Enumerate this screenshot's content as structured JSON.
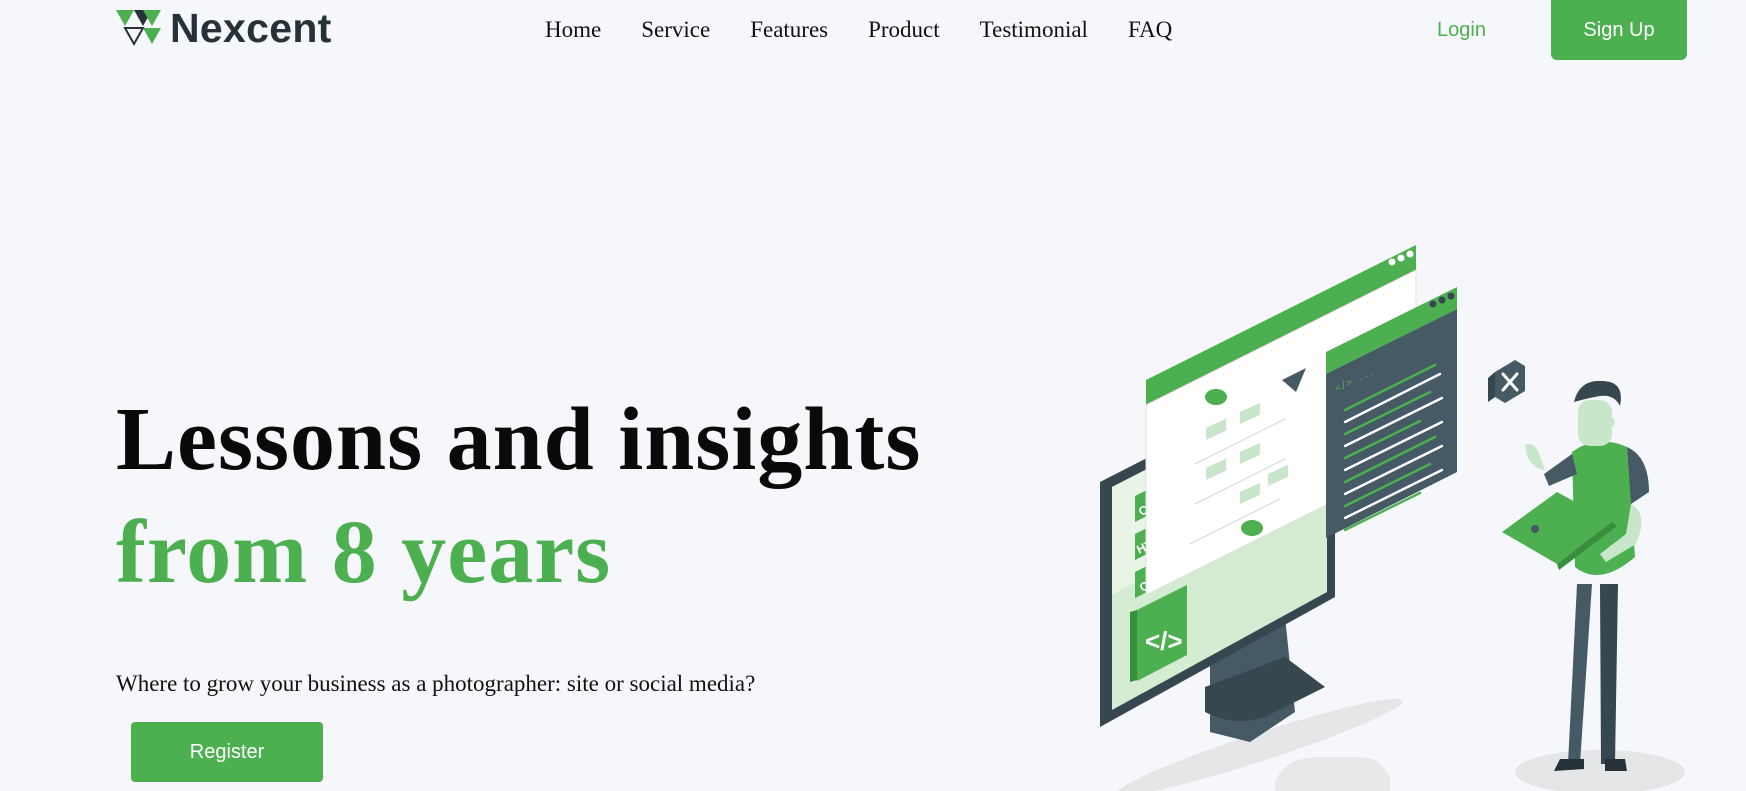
{
  "header": {
    "brand": "Nexcent",
    "nav": [
      "Home",
      "Service",
      "Features",
      "Product",
      "Testimonial",
      "FAQ"
    ],
    "login_label": "Login",
    "signup_label": "Sign Up"
  },
  "hero": {
    "title_line1": "Lessons and insights",
    "title_line2": "from 8 years",
    "subtitle": "Where to grow your business as a photographer: site or social media?",
    "register_label": "Register"
  },
  "illustration": {
    "tags": [
      "CSS",
      "HTML",
      "C++"
    ],
    "code_symbol": "</>",
    "code_window_label": "</> ..."
  },
  "colors": {
    "accent": "#4caf50",
    "dark": "#263238",
    "background": "#f5f7fa"
  },
  "icons": [
    "logo-mark",
    "close-icon",
    "code-icon",
    "laptop-icon"
  ]
}
